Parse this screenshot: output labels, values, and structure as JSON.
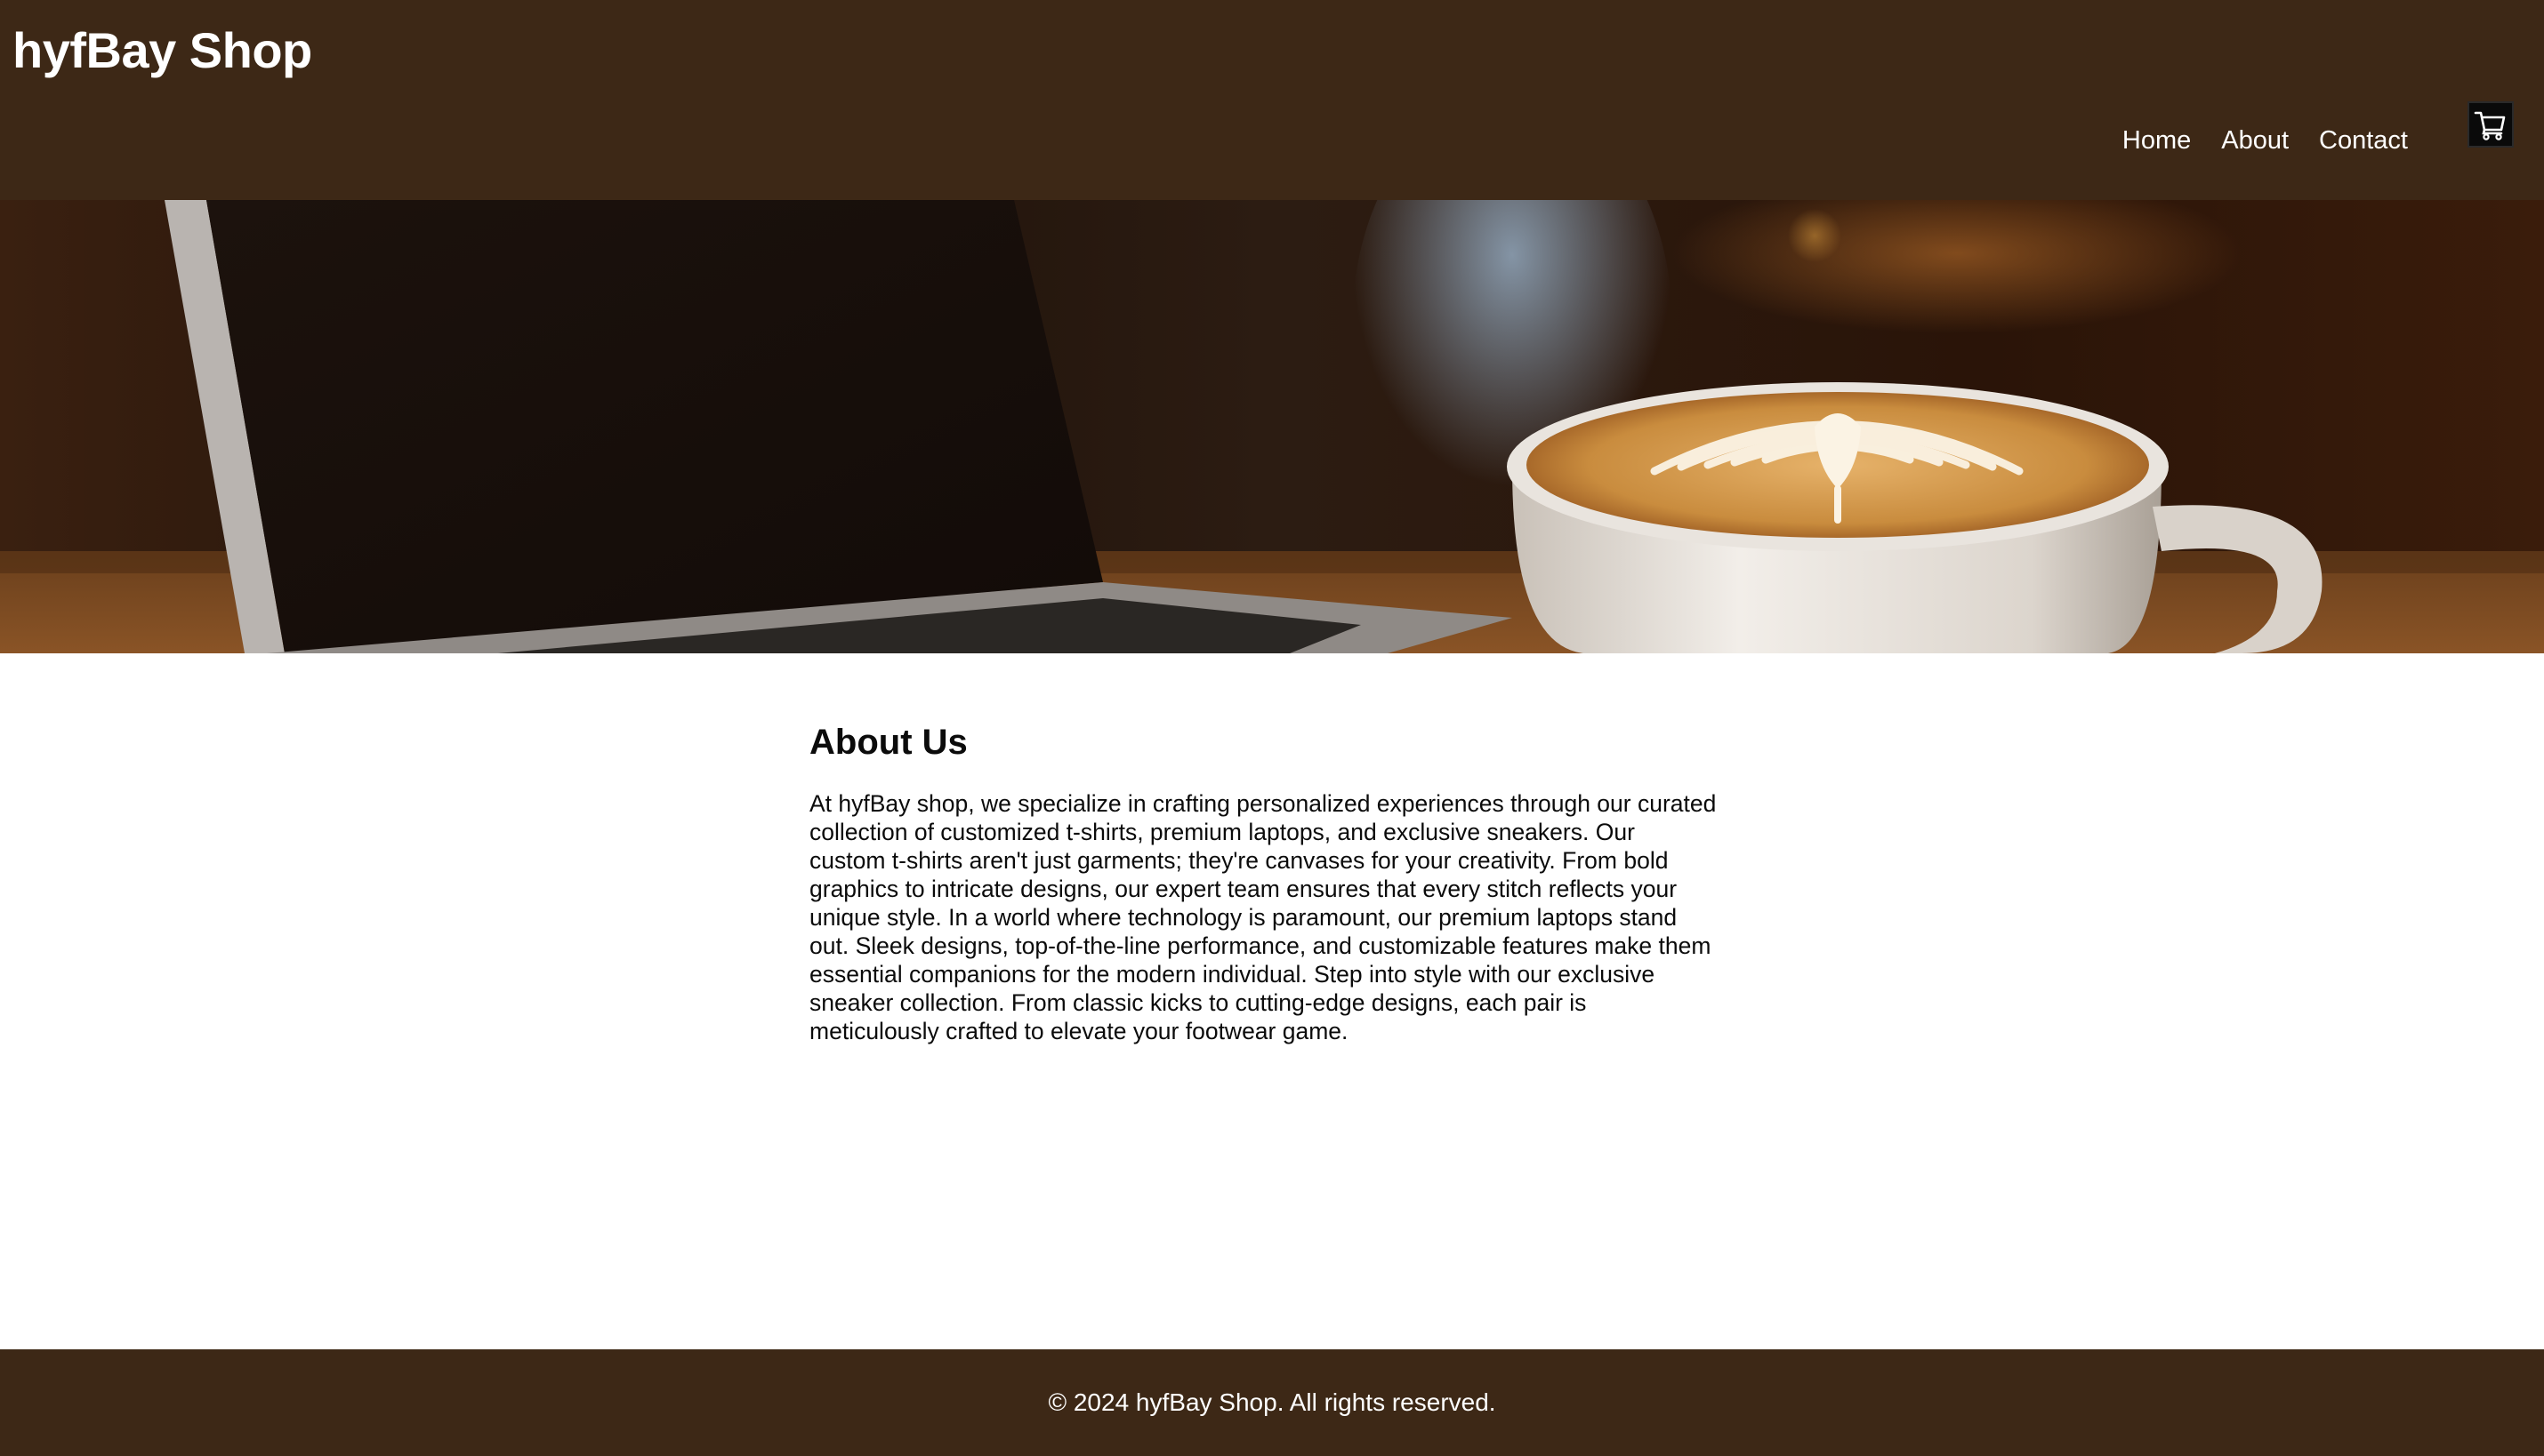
{
  "header": {
    "brand": "hyfBay Shop",
    "nav": [
      {
        "label": "Home"
      },
      {
        "label": "About"
      },
      {
        "label": "Contact"
      }
    ],
    "cart_icon": "shopping-cart-icon",
    "background_color": "#3d2816"
  },
  "hero": {
    "image": "laptop-and-latte-photo"
  },
  "about": {
    "title": "About Us",
    "body": "At hyfBay shop, we specialize in crafting personalized experiences through our curated collection of customized t-shirts, premium laptops, and exclusive sneakers. Our custom t-shirts aren't just garments; they're canvases for your creativity. From bold graphics to intricate designs, our expert team ensures that every stitch reflects your unique style. In a world where technology is paramount, our premium laptops stand out. Sleek designs, top-of-the-line performance, and customizable features make them essential companions for the modern individual. Step into style with our exclusive sneaker collection. From classic kicks to cutting-edge designs, each pair is meticulously crafted to elevate your footwear game."
  },
  "footer": {
    "copyright": "© 2024 hyfBay Shop. All rights reserved."
  }
}
